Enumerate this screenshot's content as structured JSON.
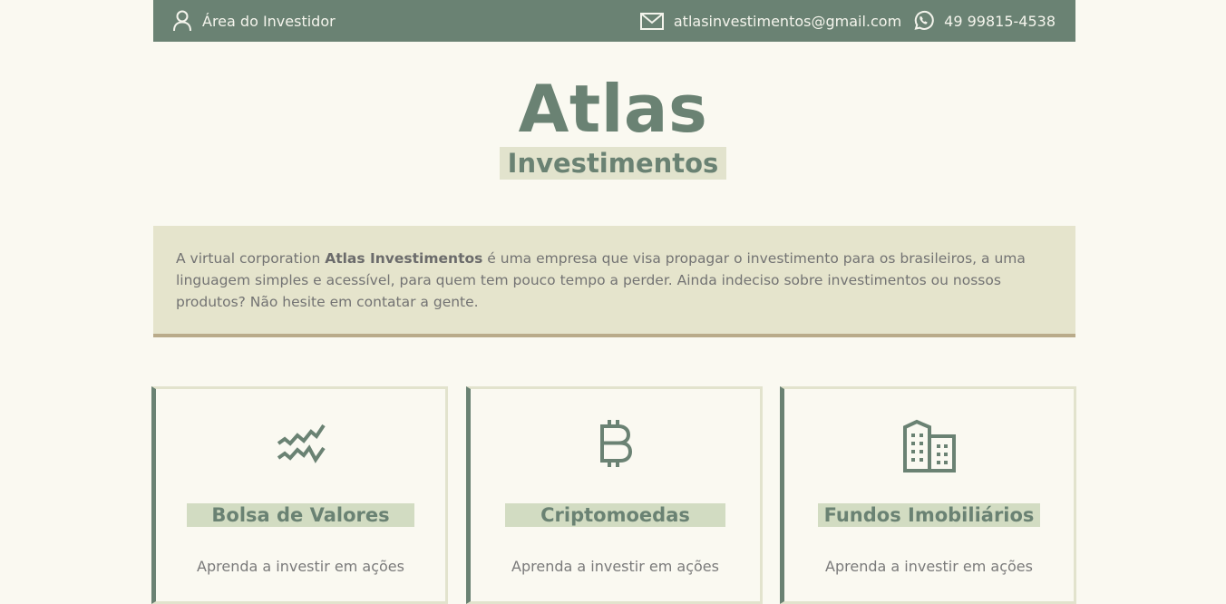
{
  "topbar": {
    "investor_area": "Área do Investidor",
    "email": "atlasinvestimentos@gmail.com",
    "phone": "49 99815-4538"
  },
  "brand": {
    "title": "Atlas",
    "subtitle": "Investimentos"
  },
  "intro": {
    "prefix": "A virtual corporation ",
    "company": "Atlas Investimentos",
    "suffix": " é uma empresa que visa propagar o investimento para os brasileiros, a uma linguagem simples e acessível, para quem tem pouco tempo a perder. Ainda indeciso sobre investimentos ou nossos produtos? Não hesite em contatar a gente."
  },
  "cards": [
    {
      "icon": "stock-chart-icon",
      "title": "Bolsa de Valores",
      "description": "Aprenda a investir em ações"
    },
    {
      "icon": "bitcoin-icon",
      "title": "Criptomoedas",
      "description": "Aprenda a investir em ações"
    },
    {
      "icon": "buildings-icon",
      "title": "Fundos Imobiliários",
      "description": "Aprenda a investir em ações"
    }
  ],
  "colors": {
    "primary": "#6a8273",
    "background": "#faf9f1",
    "intro_bg": "#e5e4cc",
    "intro_border": "#b9ab8a",
    "title_highlight": "#d2dcc2"
  }
}
